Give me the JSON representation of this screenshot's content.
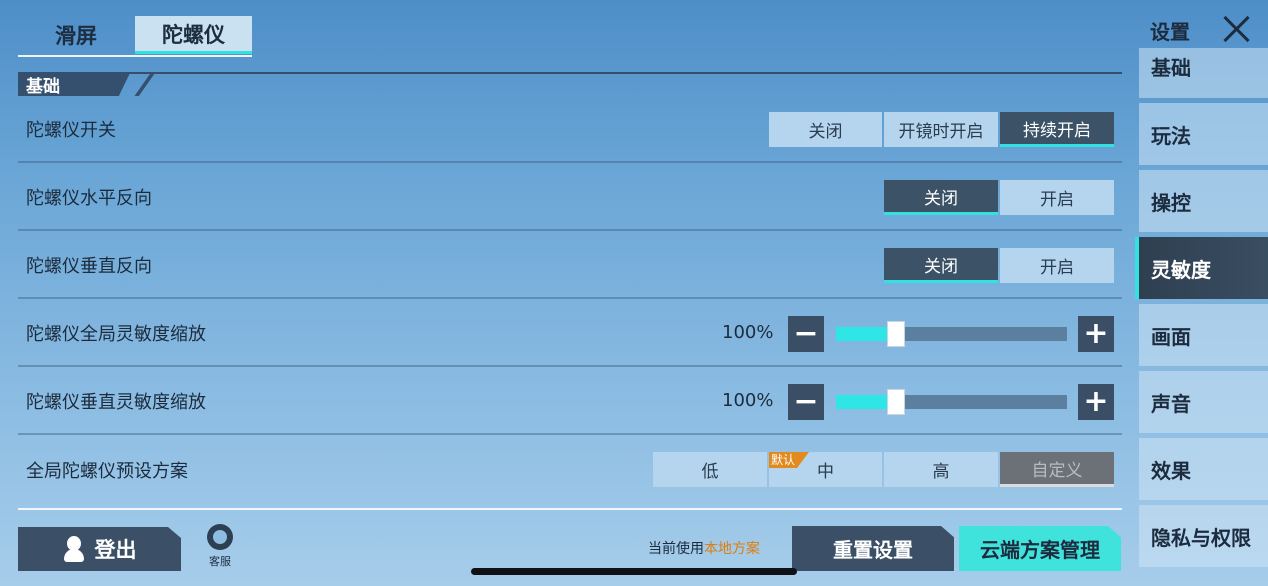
{
  "tabs": [
    {
      "label": "滑屏",
      "active": false
    },
    {
      "label": "陀螺仪",
      "active": true
    }
  ],
  "section": {
    "title": "基础"
  },
  "rows": {
    "gyro_switch": {
      "label": "陀螺仪开关",
      "options": [
        "关闭",
        "开镜时开启",
        "持续开启"
      ],
      "selected": "持续开启"
    },
    "horizontal_invert": {
      "label": "陀螺仪水平反向",
      "options": [
        "关闭",
        "开启"
      ],
      "selected": "关闭"
    },
    "vertical_invert": {
      "label": "陀螺仪垂直反向",
      "options": [
        "关闭",
        "开启"
      ],
      "selected": "关闭"
    },
    "global_scale": {
      "label": "陀螺仪全局灵敏度缩放",
      "value_text": "100%",
      "slider_fraction": 0.26
    },
    "vertical_scale": {
      "label": "陀螺仪垂直灵敏度缩放",
      "value_text": "100%",
      "slider_fraction": 0.26
    },
    "preset": {
      "label": "全局陀螺仪预设方案",
      "options": [
        "低",
        "中",
        "高",
        "自定义"
      ],
      "default_badge": "默认",
      "default_option": "中",
      "selected": "自定义"
    }
  },
  "footer": {
    "logout_label": "登出",
    "service_label": "客服",
    "current_prefix": "当前使用",
    "current_scheme": "本地方案",
    "reset_label": "重置设置",
    "cloud_label": "云端方案管理"
  },
  "sidebar": {
    "title": "设置",
    "items": [
      {
        "label": "基础",
        "active": false
      },
      {
        "label": "玩法",
        "active": false
      },
      {
        "label": "操控",
        "active": false
      },
      {
        "label": "灵敏度",
        "active": true
      },
      {
        "label": "画面",
        "active": false
      },
      {
        "label": "声音",
        "active": false
      },
      {
        "label": "效果",
        "active": false
      },
      {
        "label": "隐私与权限",
        "active": false
      }
    ]
  },
  "icons": {
    "close": "close-icon",
    "minus": "minus-icon",
    "plus": "plus-icon",
    "logout": "person-icon",
    "service": "headset-icon"
  },
  "colors": {
    "accent": "#34e1e1",
    "selected_bg": "#3c5267",
    "highlight_text": "#e07d0c",
    "default_badge": "#e38a1f"
  }
}
